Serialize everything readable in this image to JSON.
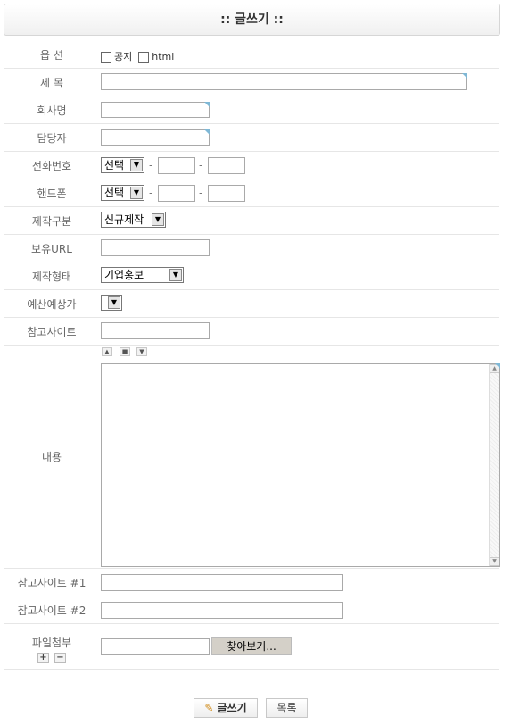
{
  "title": ":: 글쓰기 ::",
  "labels": {
    "options": "옵 션",
    "subject": "제 목",
    "company": "회사명",
    "manager": "담당자",
    "phone": "전화번호",
    "mobile": "핸드폰",
    "category": "제작구분",
    "url": "보유URL",
    "type": "제작형태",
    "budget": "예산예상가",
    "ref_site": "참고사이트",
    "content": "내용",
    "ref_site_1": "참고사이트 #1",
    "ref_site_2": "참고사이트 #2",
    "attachment": "파일첨부"
  },
  "options": {
    "notice": "공지",
    "html": "html"
  },
  "phone_select": "선택",
  "mobile_select": "선택",
  "dash": "-",
  "category_select": "신규제작",
  "type_select": "기업홍보",
  "budget_select": "",
  "browse_button": "찾아보기...",
  "write_button": "글쓰기",
  "list_button": "목록"
}
